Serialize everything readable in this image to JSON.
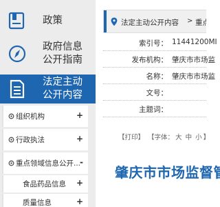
{
  "sidebar": {
    "nav": [
      {
        "label_line1": "政策",
        "label_line2": "",
        "icon": "book-icon"
      },
      {
        "label_line1": "政府信息",
        "label_line2": "公开指南",
        "icon": "compass-icon"
      },
      {
        "label_line1": "法定主动",
        "label_line2": "公开内容",
        "icon": "document-icon",
        "active": true
      }
    ],
    "sub_items": [
      {
        "label": "组织机构",
        "toggle": "+"
      },
      {
        "label": "行政执法",
        "toggle": "+"
      },
      {
        "label": "重点领域信息公开...",
        "toggle": "-"
      }
    ],
    "leaf_items": [
      {
        "label": "食品药品信息",
        "toggle": "+"
      },
      {
        "label": "质量信息",
        "toggle": "+"
      }
    ]
  },
  "breadcrumb": {
    "item1": "法定主动公开内容",
    "separator": ">",
    "item2": "重点领域"
  },
  "info": {
    "rows": [
      {
        "key": "索引号：",
        "value": "11441200MI"
      },
      {
        "key": "发布机构：",
        "value": "肇庆市市场监"
      },
      {
        "key": "名称：",
        "value": "肇庆市市场监"
      },
      {
        "key": "文号：",
        "value": ""
      },
      {
        "key": "主题词：",
        "value": ""
      }
    ]
  },
  "tools": {
    "print": "【打印】",
    "font_prefix": "【字体：",
    "big": "大",
    "medium": "中",
    "small": "小",
    "font_suffix": "】"
  },
  "article": {
    "title": "肇庆市市场监督管"
  },
  "colors": {
    "accent": "#1e66b0",
    "sidebar_bg": "#ececec"
  }
}
